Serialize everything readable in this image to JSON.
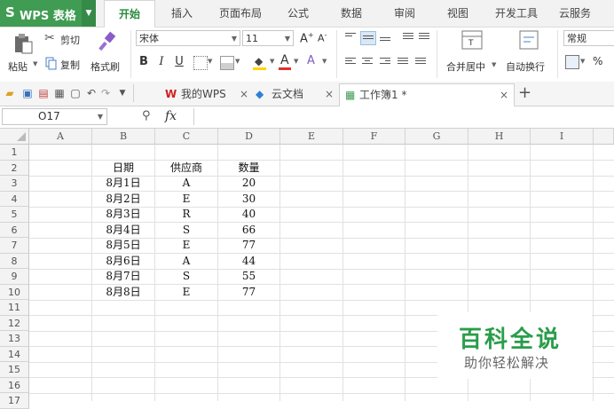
{
  "app": {
    "name": "WPS 表格",
    "logo": "S"
  },
  "menu_tabs": [
    "开始",
    "插入",
    "页面布局",
    "公式",
    "数据",
    "审阅",
    "视图",
    "开发工具",
    "云服务"
  ],
  "active_tab": "开始",
  "ribbon": {
    "paste": "粘贴",
    "cut": "剪切",
    "copy": "复制",
    "format_painter": "格式刷",
    "font_name": "宋体",
    "font_size": "11",
    "bold": "B",
    "italic": "I",
    "underline": "U",
    "merge_center": "合并居中",
    "wrap_text": "自动换行",
    "number_format": "常规",
    "percent": "%"
  },
  "doc_tabs": [
    {
      "label": "我的WPS",
      "icon": "wps-logo-icon"
    },
    {
      "label": "云文档",
      "icon": "cloud-doc-icon"
    },
    {
      "label": "工作簿1 *",
      "icon": "workbook-icon"
    }
  ],
  "formula_bar": {
    "cell_ref": "O17",
    "fx": "fx",
    "value": ""
  },
  "columns": [
    "A",
    "B",
    "C",
    "D",
    "E",
    "F",
    "G",
    "H",
    "I"
  ],
  "rows": [
    "1",
    "2",
    "3",
    "4",
    "5",
    "6",
    "7",
    "8",
    "9",
    "10",
    "11",
    "12",
    "13",
    "14",
    "15",
    "16",
    "17"
  ],
  "table": {
    "headers": [
      "日期",
      "供应商",
      "数量"
    ],
    "rows": [
      [
        "8月1日",
        "A",
        "20"
      ],
      [
        "8月2日",
        "E",
        "30"
      ],
      [
        "8月3日",
        "R",
        "40"
      ],
      [
        "8月4日",
        "S",
        "66"
      ],
      [
        "8月5日",
        "E",
        "77"
      ],
      [
        "8月6日",
        "A",
        "44"
      ],
      [
        "8月7日",
        "S",
        "55"
      ],
      [
        "8月8日",
        "E",
        "77"
      ]
    ]
  },
  "watermark": {
    "title": "百科全说",
    "subtitle": "助你轻松解决"
  },
  "colors": {
    "brand_green": "#3f9c52",
    "accent_green": "#2a8a3e",
    "watermark_green": "#2a9d4a"
  }
}
